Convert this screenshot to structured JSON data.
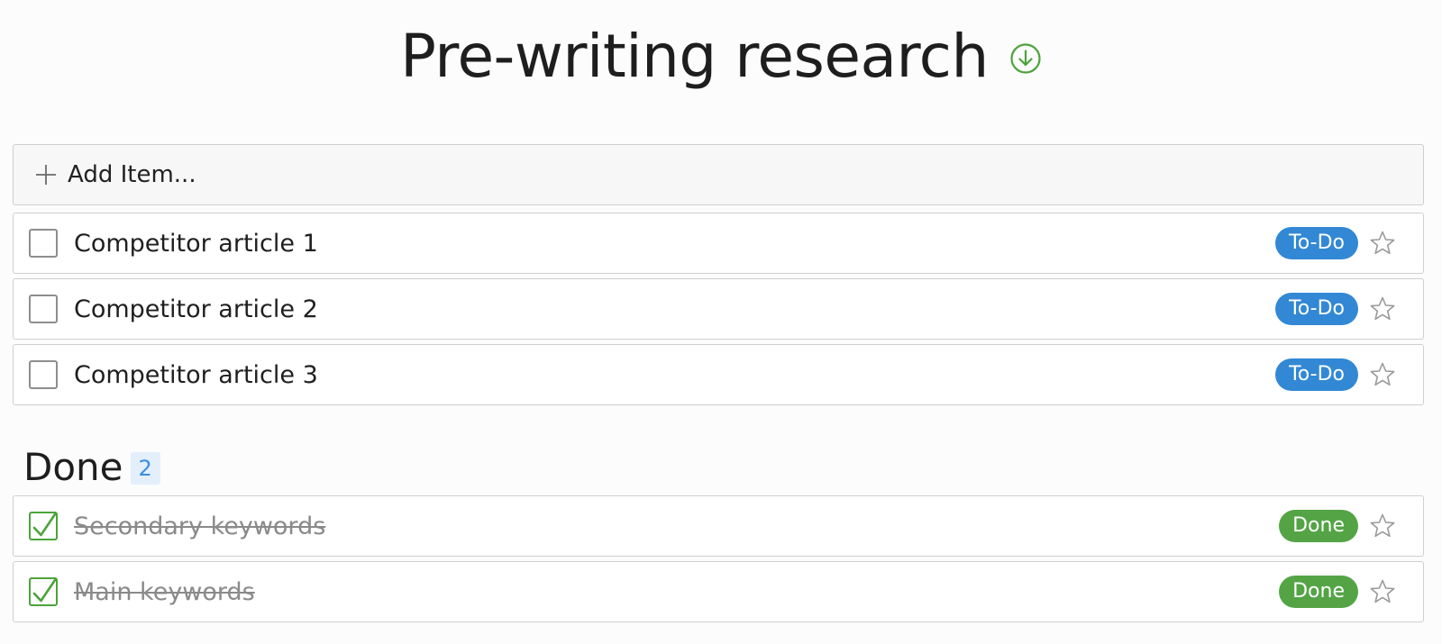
{
  "header": {
    "title": "Pre-writing research",
    "icon": "download-circle-icon",
    "accent_color": "#4ca33a"
  },
  "add_item": {
    "label": "Add Item...",
    "icon": "plus-icon"
  },
  "todo_items": [
    {
      "label": "Competitor article 1",
      "status": "To-Do",
      "checked": false,
      "starred": false
    },
    {
      "label": "Competitor article 2",
      "status": "To-Do",
      "checked": false,
      "starred": false
    },
    {
      "label": "Competitor article 3",
      "status": "To-Do",
      "checked": false,
      "starred": false
    }
  ],
  "done_section": {
    "heading": "Done",
    "count": "2",
    "items": [
      {
        "label": "Secondary keywords",
        "status": "Done",
        "checked": true,
        "starred": false
      },
      {
        "label": "Main keywords",
        "status": "Done",
        "checked": true,
        "starred": false
      }
    ]
  },
  "colors": {
    "todo_badge": "#3288d4",
    "done_badge": "#54a446",
    "checkmark": "#4ca33a",
    "count_badge_bg": "#e3effb",
    "count_badge_text": "#3a8de0"
  }
}
